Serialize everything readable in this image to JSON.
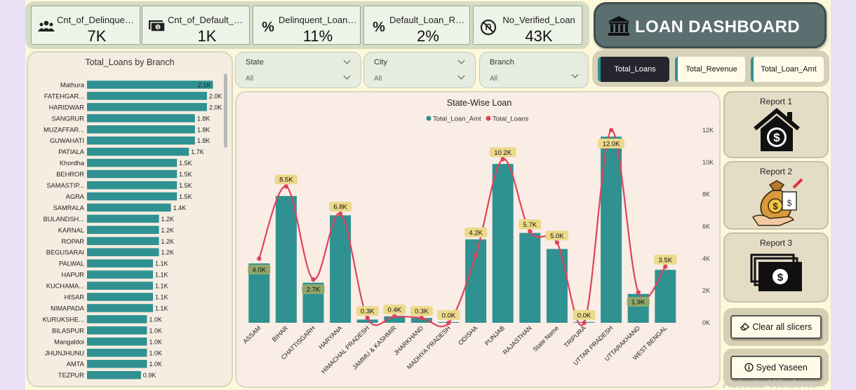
{
  "dashboard_title": "LOAN DASHBOARD",
  "kpis": [
    {
      "label": "Cnt_of_Delinquen...",
      "value": "7K",
      "icon": "people-icon"
    },
    {
      "label": "Cnt_of_Default_Lo...",
      "value": "1K",
      "icon": "money-icon"
    },
    {
      "label": "Delinquent_Loans...",
      "value": "11%",
      "icon": "percent-icon"
    },
    {
      "label": "Default_Loan_Rate",
      "value": "2%",
      "icon": "percent-icon"
    },
    {
      "label": "No_Verified_Loan",
      "value": "43K",
      "icon": "no-verified-icon"
    }
  ],
  "slicers": [
    {
      "label": "State",
      "value": "All"
    },
    {
      "label": "City",
      "value": "All"
    },
    {
      "label": "Branch",
      "value": "All"
    }
  ],
  "measure_buttons": [
    {
      "label": "Total_Loans",
      "active": true
    },
    {
      "label": "Total_Revenue",
      "active": false
    },
    {
      "label": "Total_Loan_Amt",
      "active": false
    }
  ],
  "reports": [
    {
      "label": "Report 1",
      "icon": "house-dollar-icon"
    },
    {
      "label": "Report 2",
      "icon": "money-bag-icon"
    },
    {
      "label": "Report 3",
      "icon": "banknote-stack-icon"
    }
  ],
  "action_buttons": {
    "clear_label": "Clear all slicers",
    "author_label": "Syed Yaseen"
  },
  "watermark": "Activate Windows",
  "colors": {
    "teal": "#2f9191",
    "red": "#e0435a",
    "label_bg": "#ecd98a",
    "dark_button": "#25252f"
  },
  "chart_data": [
    {
      "type": "bar",
      "title": "Total_Loans by Branch",
      "orientation": "horizontal",
      "categories": [
        "Mathura",
        "FATEHGAR...",
        "HARIDWAR",
        "SANGRUR",
        "MUZAFFAR...",
        "GUWAHATI",
        "PATIALA",
        "Khordha",
        "BEHROR",
        "SAMASTIP...",
        "AGRA",
        "SAMRALA",
        "BULANDSH...",
        "KARNAL",
        "ROPAR",
        "BEGUSARAI",
        "PALWAL",
        "HAPUR",
        "KUCHAMA...",
        "HISAR",
        "NIMAPADA",
        "KURUKSHE...",
        "BILASPUR",
        "Mangaldoi",
        "JHUNJHUNU",
        "AMTA",
        "TEZPUR"
      ],
      "values": [
        2.1,
        2.0,
        2.0,
        1.8,
        1.8,
        1.8,
        1.7,
        1.5,
        1.5,
        1.5,
        1.5,
        1.4,
        1.2,
        1.2,
        1.2,
        1.2,
        1.1,
        1.1,
        1.1,
        1.1,
        1.1,
        1.0,
        1.0,
        1.0,
        1.0,
        1.0,
        0.9
      ],
      "data_labels": [
        "2.1K",
        "2.0K",
        "2.0K",
        "1.8K",
        "1.8K",
        "1.8K",
        "1.7K",
        "1.5K",
        "1.5K",
        "1.5K",
        "1.5K",
        "1.4K",
        "1.2K",
        "1.2K",
        "1.2K",
        "1.2K",
        "1.1K",
        "1.1K",
        "1.1K",
        "1.1K",
        "1.1K",
        "1.0K",
        "1.0K",
        "1.0K",
        "1.0K",
        "1.0K",
        "0.9K"
      ],
      "xlim": [
        0,
        2.2
      ],
      "color": "#2f9191"
    },
    {
      "type": "bar",
      "title": "State-Wise Loan",
      "categories": [
        "ASSAM",
        "BIHAR",
        "CHATTISGARH",
        "HARYANA",
        "HIMACHAL PRADESH",
        "JAMMU & KASHMIR",
        "JHARKHAND",
        "MADHYA PRADESH",
        "ODISHA",
        "PUNJAB",
        "RAJASTHAN",
        "State Name",
        "TRIPURA",
        "UTTAR PRADESH",
        "UTTARAKHAND",
        "WEST BENGAL"
      ],
      "series": [
        {
          "name": "Total_Loan_Amt",
          "type": "bar",
          "axis": "left",
          "values": [
            370,
            790,
            250,
            670,
            20,
            40,
            30,
            5,
            520,
            990,
            560,
            460,
            5,
            1160,
            180,
            330
          ],
          "color": "#2f9191"
        },
        {
          "name": "Total_Loans",
          "type": "line",
          "axis": "right",
          "values": [
            4000,
            8500,
            2700,
            6800,
            300,
            400,
            300,
            0,
            4200,
            10200,
            5700,
            5000,
            0,
            12000,
            1900,
            3500
          ],
          "color": "#e0435a"
        }
      ],
      "data_labels": [
        "4.0K",
        "8.5K",
        "2.7K",
        "6.8K",
        "0.3K",
        "0.4K",
        "0.3K",
        "0.0K",
        "4.2K",
        "10.2K",
        "5.7K",
        "5.0K",
        "0.0K",
        "12.0K",
        "1.9K",
        "3.5K"
      ],
      "y2_ticks": [
        "0K",
        "2K",
        "4K",
        "6K",
        "8K",
        "10K",
        "12K"
      ],
      "y2lim": [
        0,
        12000
      ],
      "ylim": [
        0,
        1200
      ],
      "legend_position": "top"
    }
  ]
}
